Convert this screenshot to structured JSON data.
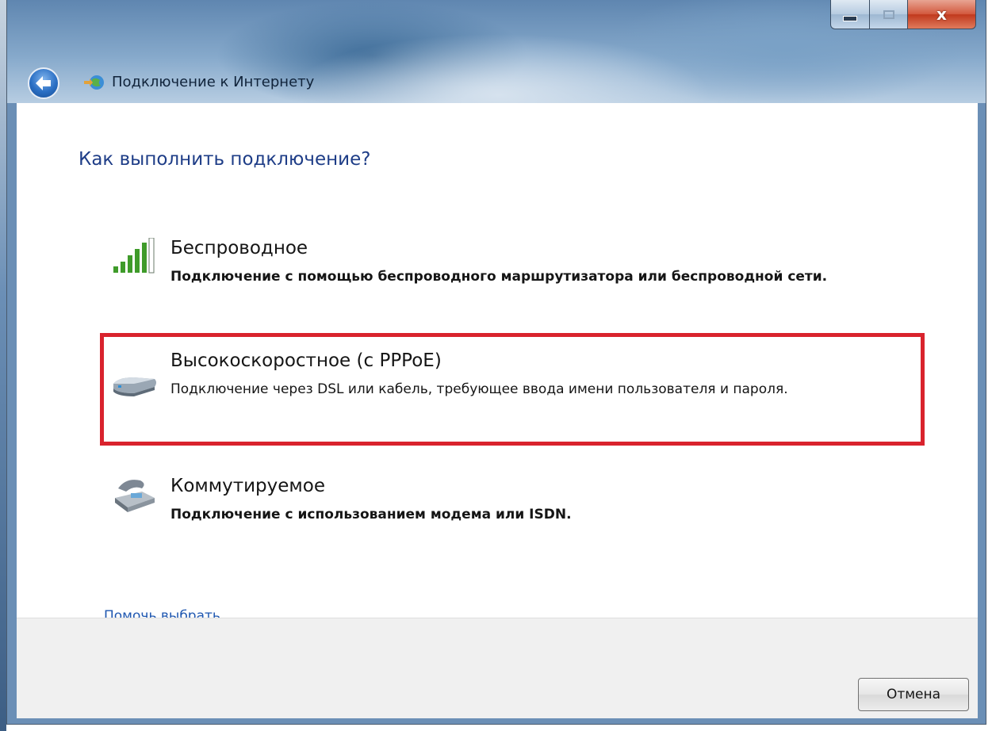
{
  "window": {
    "title": "Подключение к Интернету",
    "controls": {
      "minimize": "minimize",
      "maximize": "maximize",
      "close": "x"
    }
  },
  "main": {
    "heading": "Как выполнить подключение?",
    "options": [
      {
        "title": "Беспроводное",
        "description": "Подключение с помощью беспроводного маршрутизатора или беспроводной сети.",
        "icon": "wireless-signal-icon"
      },
      {
        "title": "Высокоскоростное (с PPPoE)",
        "description": "Подключение через DSL или кабель, требующее ввода имени пользователя и пароля.",
        "icon": "broadband-modem-icon",
        "highlighted": true
      },
      {
        "title": "Коммутируемое",
        "description": "Подключение с использованием модема или ISDN.",
        "icon": "dialup-phone-icon"
      }
    ],
    "help_link": "Помочь выбрать"
  },
  "footer": {
    "cancel_label": "Отмена"
  },
  "colors": {
    "highlight": "#d9232d",
    "heading": "#1e3d87",
    "link": "#1f57b0"
  }
}
